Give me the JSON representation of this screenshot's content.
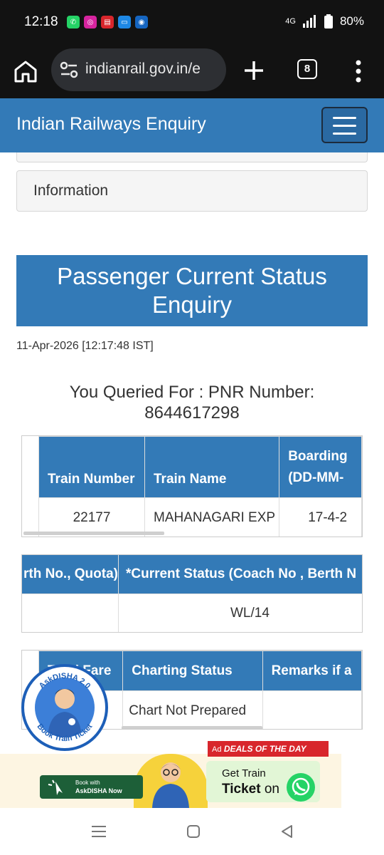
{
  "status_bar": {
    "time": "12:18",
    "network": "4G",
    "battery": "80%"
  },
  "browser": {
    "url": "indianrail.gov.in/e",
    "tab_count": "8"
  },
  "navbar": {
    "brand": "Indian Railways Enquiry"
  },
  "info_panel": {
    "label": "Information"
  },
  "page_title": {
    "line1": "Passenger Current Status",
    "line2": "Enquiry"
  },
  "timestamp": "11-Apr-2026 [12:17:48 IST]",
  "query": {
    "line1": "You Queried For : PNR Number:",
    "line2": "8644617298"
  },
  "train_table": {
    "headers": {
      "train_number": "Train Number",
      "train_name": "Train Name",
      "boarding_1": "Boarding",
      "boarding_2": "(DD-MM-"
    },
    "row": {
      "train_number": "22177",
      "train_name": "MAHANAGARI EXP",
      "boarding_date": "17-4-2"
    }
  },
  "status_table": {
    "headers": {
      "booking": "rth No., Quota)",
      "current": "*Current Status (Coach No , Berth N"
    },
    "row": {
      "booking": "",
      "current": "WL/14"
    }
  },
  "fare_table": {
    "headers": {
      "fare": "Total Fare",
      "charting": "Charting Status",
      "remarks": "Remarks if a"
    },
    "row": {
      "fare": "",
      "charting": "Chart Not Prepared",
      "remarks": ""
    }
  },
  "askdisha": {
    "top": "AskDISHA 2.0",
    "bottom": "Book Train Ticket"
  },
  "ad_banner": {
    "deals": "DEALS OF THE DAY",
    "ad_label": "Ad",
    "book_line1": "Book with",
    "book_line2": "AskDISHA Now",
    "get_line1": "Get Train",
    "get_line2_bold": "Ticket",
    "get_line2_rest": " on"
  }
}
